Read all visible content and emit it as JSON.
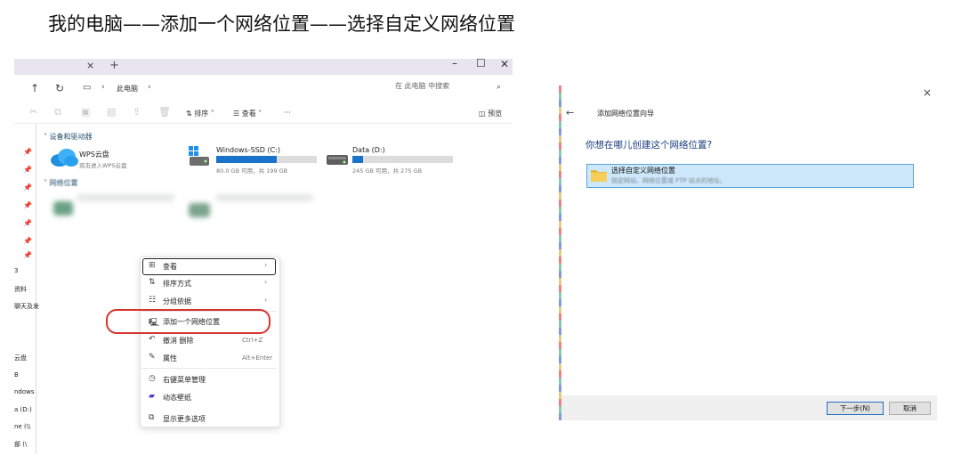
{
  "heading": "我的电脑——添加一个网络位置——选择自定义网络位置",
  "explorer": {
    "tab_close": "×",
    "tab_add": "+",
    "breadcrumb": "此电脑",
    "search_placeholder": "在 此电脑 中搜索",
    "toolbar": {
      "sort": "排序",
      "view": "查看",
      "more": "···",
      "preview": "预览"
    },
    "sidebar_labels": [
      "3",
      "资料",
      "聊天及发",
      "云盘",
      "B",
      "ndows",
      "a (D:)",
      "ne (\\\\",
      "部 (\\"
    ],
    "groups": {
      "devices": "设备和驱动器",
      "network": "网络位置"
    },
    "drives": [
      {
        "name": "WPS云盘",
        "sub": "双击进入WPS云盘"
      },
      {
        "name": "Windows-SSD (C:)",
        "sub": "80.0 GB 可用，共 199 GB",
        "used_fraction": 0.6
      },
      {
        "name": "Data (D:)",
        "sub": "245 GB 可用，共 275 GB",
        "used_fraction": 0.11
      }
    ],
    "context_menu": {
      "items": [
        {
          "label": "查看",
          "icon": "grid-icon",
          "has_submenu": true
        },
        {
          "label": "排序方式",
          "icon": "sort-icon",
          "has_submenu": true
        },
        {
          "label": "分组依据",
          "icon": "group-icon",
          "has_submenu": true
        },
        {
          "label": "添加一个网络位置",
          "icon": "network-location-icon",
          "has_submenu": false
        },
        {
          "label": "撤消 删除",
          "icon": "undo-icon",
          "shortcut": "Ctrl+Z"
        },
        {
          "label": "属性",
          "icon": "properties-icon",
          "shortcut": "Alt+Enter"
        },
        {
          "label": "右键菜单管理",
          "icon": "menu-manager-icon"
        },
        {
          "label": "动态壁纸",
          "icon": "wallpaper-icon"
        },
        {
          "label": "显示更多选项",
          "icon": "more-options-icon"
        }
      ]
    }
  },
  "wizard": {
    "close": "×",
    "back": "←",
    "title": "添加网络位置向导",
    "question": "你想在哪儿创建这个网络位置?",
    "option_title": "选择自定义网络位置",
    "option_desc": "指定网站、网络位置或 FTP 站点的地址。",
    "next_button": "下一步(N)",
    "cancel_button": "取消"
  }
}
